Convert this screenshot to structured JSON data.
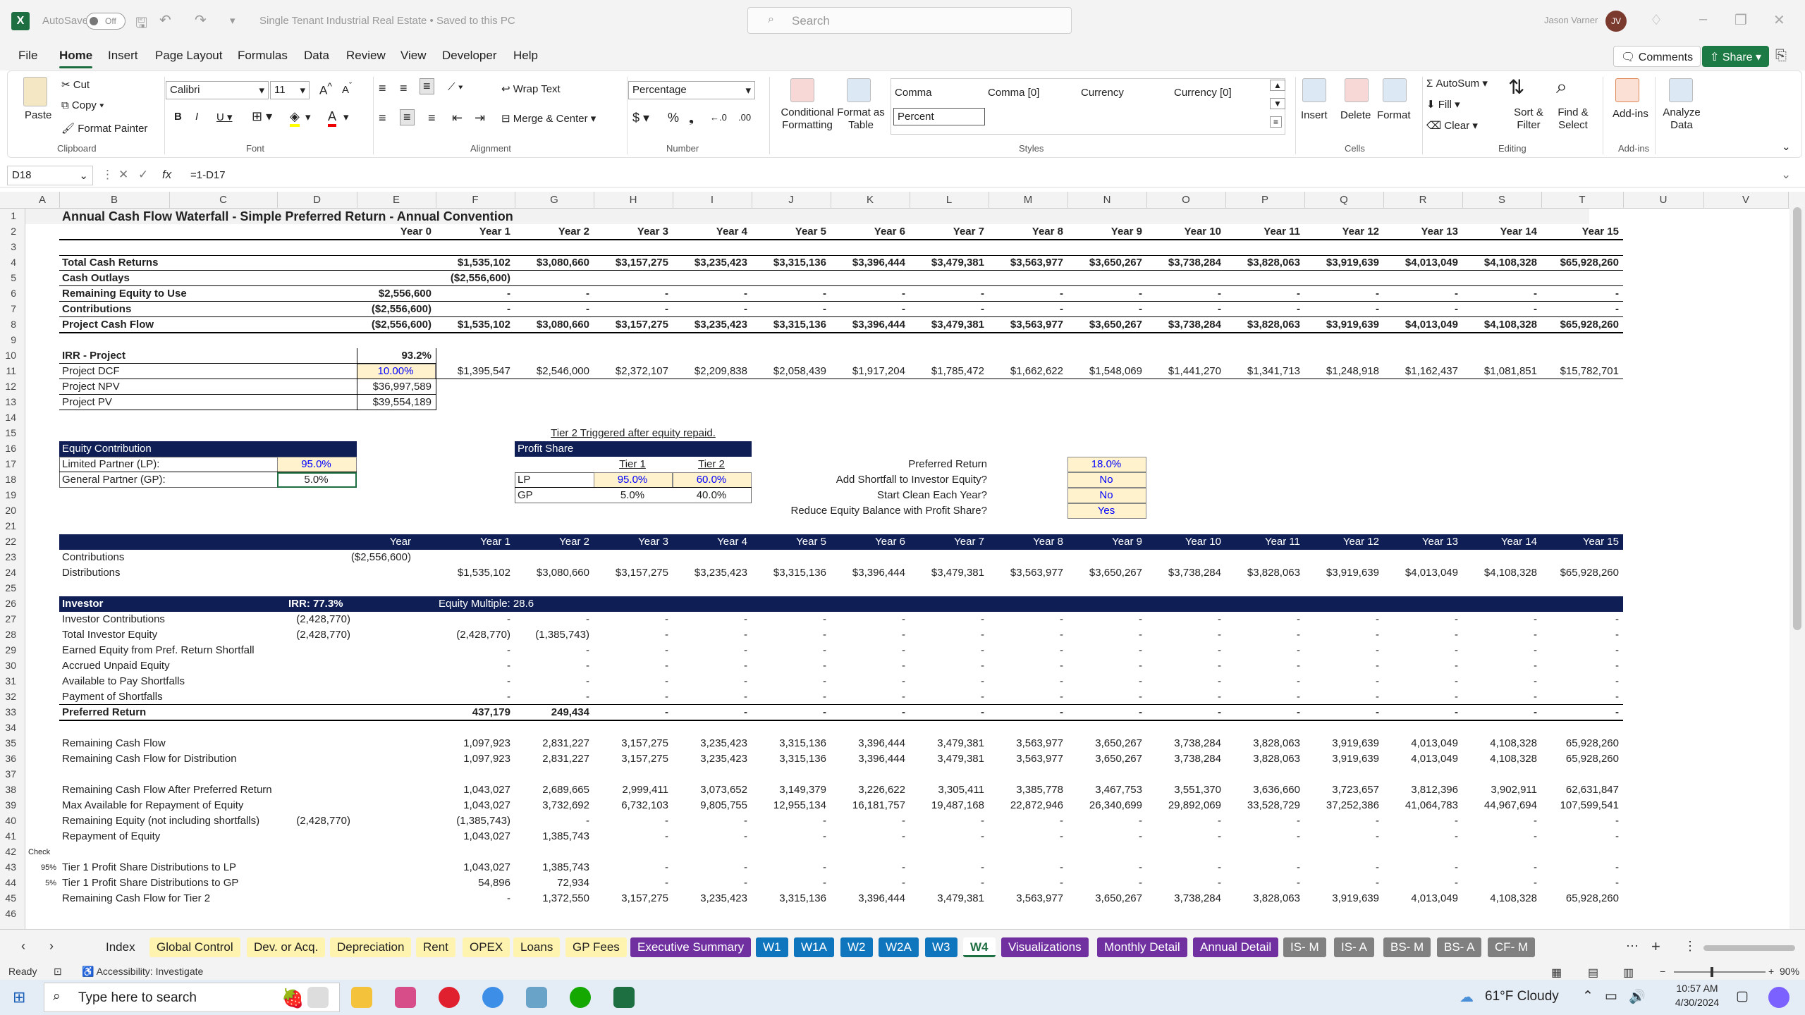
{
  "titlebar": {
    "autosave": "AutoSave",
    "toggle": "Off",
    "doc_title": "Single Tenant Industrial Real Estate • Saved to this PC",
    "search_placeholder": "Search",
    "user": "Jason Varner",
    "initials": "JV"
  },
  "menu": {
    "tabs": [
      "File",
      "Home",
      "Insert",
      "Page Layout",
      "Formulas",
      "Data",
      "Review",
      "View",
      "Developer",
      "Help"
    ],
    "active": "Home",
    "comments": "Comments",
    "share": "Share"
  },
  "ribbon": {
    "paste": "Paste",
    "cut": "Cut",
    "copy": "Copy",
    "format_painter": "Format Painter",
    "clipboard": "Clipboard",
    "font_name": "Calibri",
    "font_size": "11",
    "font": "Font",
    "wrap_text": "Wrap Text",
    "merge_center": "Merge & Center",
    "alignment": "Alignment",
    "number_format": "Percentage",
    "number": "Number",
    "cond_format": "Conditional Formatting",
    "format_table": "Format as Table",
    "styles_gallery": [
      "Comma",
      "Comma [0]",
      "Currency",
      "Currency [0]",
      "Percent"
    ],
    "styles": "Styles",
    "insert": "Insert",
    "delete": "Delete",
    "format": "Format",
    "cells": "Cells",
    "autosum": "AutoSum",
    "fill": "Fill",
    "clear": "Clear",
    "sort_filter": "Sort & Filter",
    "find_select": "Find & Select",
    "editing": "Editing",
    "addins": "Add-ins",
    "addins_group": "Add-ins",
    "analyze": "Analyze Data"
  },
  "formula_bar": {
    "name_box": "D18",
    "formula": "=1-D17"
  },
  "columns": [
    "A",
    "B",
    "C",
    "D",
    "E",
    "F",
    "G",
    "H",
    "I",
    "J",
    "K",
    "L",
    "M",
    "N",
    "O",
    "P",
    "Q",
    "R",
    "S",
    "T",
    "U",
    "V"
  ],
  "sheet": {
    "title": "Annual Cash Flow Waterfall - Simple Preferred Return - Annual Convention",
    "years": [
      "Year 0",
      "Year 1",
      "Year 2",
      "Year 3",
      "Year 4",
      "Year 5",
      "Year 6",
      "Year 7",
      "Year 8",
      "Year 9",
      "Year 10",
      "Year 11",
      "Year 12",
      "Year 13",
      "Year 14",
      "Year 15"
    ],
    "top_rows": [
      {
        "row": 4,
        "label": "Total Cash Returns",
        "e": "",
        "vals": [
          "$1,535,102",
          "$3,080,660",
          "$3,157,275",
          "$3,235,423",
          "$3,315,136",
          "$3,396,444",
          "$3,479,381",
          "$3,563,977",
          "$3,650,267",
          "$3,738,284",
          "$3,828,063",
          "$3,919,639",
          "$4,013,049",
          "$4,108,328",
          "$65,928,260"
        ]
      },
      {
        "row": 5,
        "label": "Cash Outlays",
        "e": "",
        "vals": [
          "($2,556,600)",
          "",
          "",
          "",
          "",
          "",
          "",
          "",
          "",
          "",
          "",
          "",
          "",
          "",
          ""
        ]
      },
      {
        "row": 6,
        "label": "Remaining Equity to Use",
        "e": "$2,556,600",
        "vals": [
          "-",
          "-",
          "-",
          "-",
          "-",
          "-",
          "-",
          "-",
          "-",
          "-",
          "-",
          "-",
          "-",
          "-",
          "-"
        ]
      },
      {
        "row": 7,
        "label": "Contributions",
        "e": "($2,556,600)",
        "vals": [
          "-",
          "-",
          "-",
          "-",
          "-",
          "-",
          "-",
          "-",
          "-",
          "-",
          "-",
          "-",
          "-",
          "-",
          "-"
        ]
      },
      {
        "row": 8,
        "label": "Project Cash Flow",
        "e": "($2,556,600)",
        "vals": [
          "$1,535,102",
          "$3,080,660",
          "$3,157,275",
          "$3,235,423",
          "$3,315,136",
          "$3,396,444",
          "$3,479,381",
          "$3,563,977",
          "$3,650,267",
          "$3,738,284",
          "$3,828,063",
          "$3,919,639",
          "$4,013,049",
          "$4,108,328",
          "$65,928,260"
        ]
      }
    ],
    "irr_label": "IRR - Project",
    "irr_value": "93.2%",
    "dcf_label": "Project DCF",
    "dcf_rate": "10.00%",
    "dcf_vals": [
      "$1,395,547",
      "$2,546,000",
      "$2,372,107",
      "$2,209,838",
      "$2,058,439",
      "$1,917,204",
      "$1,785,472",
      "$1,662,622",
      "$1,548,069",
      "$1,441,270",
      "$1,341,713",
      "$1,248,918",
      "$1,162,437",
      "$1,081,851",
      "$15,782,701"
    ],
    "npv_label": "Project NPV",
    "npv": "$36,997,589",
    "pv_label": "Project PV",
    "pv": "$39,554,189",
    "equity": {
      "header": "Equity Contribution",
      "lp_label": "Limited Partner (LP):",
      "lp": "95.0%",
      "gp_label": "General Partner (GP):",
      "gp": "5.0%"
    },
    "profit": {
      "note": "Tier 2 Triggered after equity repaid.",
      "header": "Profit Share",
      "tier1": "Tier 1",
      "tier2": "Tier 2",
      "lp": "LP",
      "gp": "GP",
      "lp_t1": "95.0%",
      "lp_t2": "60.0%",
      "gp_t1": "5.0%",
      "gp_t2": "40.0%"
    },
    "options": [
      {
        "label": "Preferred Return",
        "value": "18.0%"
      },
      {
        "label": "Add Shortfall to Investor Equity?",
        "value": "No"
      },
      {
        "label": "Start Clean Each Year?",
        "value": "No"
      },
      {
        "label": "Reduce Equity Balance with Profit Share?",
        "value": "Yes"
      }
    ],
    "dist_header": "Year",
    "contrib_label": "Contributions",
    "contrib_e": "($2,556,600)",
    "distrib_label": "Distributions",
    "distrib_vals": [
      "$1,535,102",
      "$3,080,660",
      "$3,157,275",
      "$3,235,423",
      "$3,315,136",
      "$3,396,444",
      "$3,479,381",
      "$3,563,977",
      "$3,650,267",
      "$3,738,284",
      "$3,828,063",
      "$3,919,639",
      "$4,013,049",
      "$4,108,328",
      "$65,928,260"
    ],
    "investor": {
      "label": "Investor",
      "irr": "IRR: 77.3%",
      "multiple": "Equity Multiple: 28.6"
    },
    "inv_rows": [
      {
        "row": 27,
        "label": "Investor Contributions",
        "e": "(2,428,770)",
        "vals": [
          "-",
          "-",
          "-",
          "-",
          "-",
          "-",
          "-",
          "-",
          "-",
          "-",
          "-",
          "-",
          "-",
          "-",
          "-"
        ]
      },
      {
        "row": 28,
        "label": "Total Investor Equity",
        "e": "(2,428,770)",
        "vals": [
          "(2,428,770)",
          "(1,385,743)",
          "-",
          "-",
          "-",
          "-",
          "-",
          "-",
          "-",
          "-",
          "-",
          "-",
          "-",
          "-",
          "-"
        ]
      },
      {
        "row": 29,
        "label": "Earned Equity from Pref. Return Shortfall",
        "e": "",
        "vals": [
          "-",
          "-",
          "-",
          "-",
          "-",
          "-",
          "-",
          "-",
          "-",
          "-",
          "-",
          "-",
          "-",
          "-",
          "-"
        ]
      },
      {
        "row": 30,
        "label": "Accrued Unpaid Equity",
        "e": "",
        "vals": [
          "-",
          "-",
          "-",
          "-",
          "-",
          "-",
          "-",
          "-",
          "-",
          "-",
          "-",
          "-",
          "-",
          "-",
          "-"
        ]
      },
      {
        "row": 31,
        "label": "Available to Pay Shortfalls",
        "e": "",
        "vals": [
          "-",
          "-",
          "-",
          "-",
          "-",
          "-",
          "-",
          "-",
          "-",
          "-",
          "-",
          "-",
          "-",
          "-",
          "-"
        ]
      },
      {
        "row": 32,
        "label": "Payment of Shortfalls",
        "e": "",
        "vals": [
          "-",
          "-",
          "-",
          "-",
          "-",
          "-",
          "-",
          "-",
          "-",
          "-",
          "-",
          "-",
          "-",
          "-",
          "-"
        ]
      },
      {
        "row": 33,
        "label": "Preferred Return",
        "e": "",
        "vals": [
          "437,179",
          "249,434",
          "-",
          "-",
          "-",
          "-",
          "-",
          "-",
          "-",
          "-",
          "-",
          "-",
          "-",
          "-",
          "-"
        ]
      },
      {
        "row": 35,
        "label": "Remaining Cash Flow",
        "e": "",
        "vals": [
          "1,097,923",
          "2,831,227",
          "3,157,275",
          "3,235,423",
          "3,315,136",
          "3,396,444",
          "3,479,381",
          "3,563,977",
          "3,650,267",
          "3,738,284",
          "3,828,063",
          "3,919,639",
          "4,013,049",
          "4,108,328",
          "65,928,260"
        ]
      },
      {
        "row": 36,
        "label": "Remaining Cash Flow for Distribution",
        "e": "",
        "vals": [
          "1,097,923",
          "2,831,227",
          "3,157,275",
          "3,235,423",
          "3,315,136",
          "3,396,444",
          "3,479,381",
          "3,563,977",
          "3,650,267",
          "3,738,284",
          "3,828,063",
          "3,919,639",
          "4,013,049",
          "4,108,328",
          "65,928,260"
        ]
      },
      {
        "row": 38,
        "label": "Remaining Cash Flow After Preferred Return",
        "e": "",
        "vals": [
          "1,043,027",
          "2,689,665",
          "2,999,411",
          "3,073,652",
          "3,149,379",
          "3,226,622",
          "3,305,411",
          "3,385,778",
          "3,467,753",
          "3,551,370",
          "3,636,660",
          "3,723,657",
          "3,812,396",
          "3,902,911",
          "62,631,847"
        ]
      },
      {
        "row": 39,
        "label": "Max Available for Repayment of Equity",
        "e": "",
        "vals": [
          "1,043,027",
          "3,732,692",
          "6,732,103",
          "9,805,755",
          "12,955,134",
          "16,181,757",
          "19,487,168",
          "22,872,946",
          "26,340,699",
          "29,892,069",
          "33,528,729",
          "37,252,386",
          "41,064,783",
          "44,967,694",
          "107,599,541"
        ]
      },
      {
        "row": 40,
        "label": "Remaining Equity (not including shortfalls)",
        "e": "(2,428,770)",
        "vals": [
          "(1,385,743)",
          "-",
          "-",
          "-",
          "-",
          "-",
          "-",
          "-",
          "-",
          "-",
          "-",
          "-",
          "-",
          "-",
          "-"
        ]
      },
      {
        "row": 41,
        "label": "Repayment of Equity",
        "e": "",
        "vals": [
          "1,043,027",
          "1,385,743",
          "-",
          "-",
          "-",
          "-",
          "-",
          "-",
          "-",
          "-",
          "-",
          "-",
          "-",
          "-",
          "-"
        ]
      },
      {
        "row": 43,
        "label": "Tier 1 Profit Share Distributions to LP",
        "e": "",
        "vals": [
          "1,043,027",
          "1,385,743",
          "-",
          "-",
          "-",
          "-",
          "-",
          "-",
          "-",
          "-",
          "-",
          "-",
          "-",
          "-",
          "-"
        ]
      },
      {
        "row": 44,
        "label": "Tier 1 Profit Share Distributions to GP",
        "e": "",
        "vals": [
          "54,896",
          "72,934",
          "-",
          "-",
          "-",
          "-",
          "-",
          "-",
          "-",
          "-",
          "-",
          "-",
          "-",
          "-",
          "-"
        ]
      },
      {
        "row": 45,
        "label": "Remaining Cash Flow for Tier 2",
        "e": "",
        "vals": [
          "-",
          "1,372,550",
          "3,157,275",
          "3,235,423",
          "3,315,136",
          "3,396,444",
          "3,479,381",
          "3,563,977",
          "3,650,267",
          "3,738,284",
          "3,828,063",
          "3,919,639",
          "4,013,049",
          "4,108,328",
          "65,928,260"
        ]
      }
    ],
    "check_label": "Check",
    "pct95": "95%",
    "pct5": "5%"
  },
  "sheet_tabs": [
    "Index",
    "Global Control",
    "Dev. or Acq.",
    "Depreciation",
    "Rent",
    "OPEX",
    "Loans",
    "GP Fees",
    "Executive Summary",
    "W1",
    "W1A",
    "W2",
    "W2A",
    "W3",
    "W4",
    "Visualizations",
    "Monthly Detail",
    "Annual Detail",
    "IS- M",
    "IS- A",
    "BS- M",
    "BS- A",
    "CF- M"
  ],
  "active_sheet": "W4",
  "status": {
    "ready": "Ready",
    "accessibility": "Accessibility: Investigate",
    "zoom": "90%"
  },
  "taskbar": {
    "search": "Type here to search",
    "weather": "61°F  Cloudy",
    "time": "10:57 AM",
    "date": "4/30/2024"
  }
}
